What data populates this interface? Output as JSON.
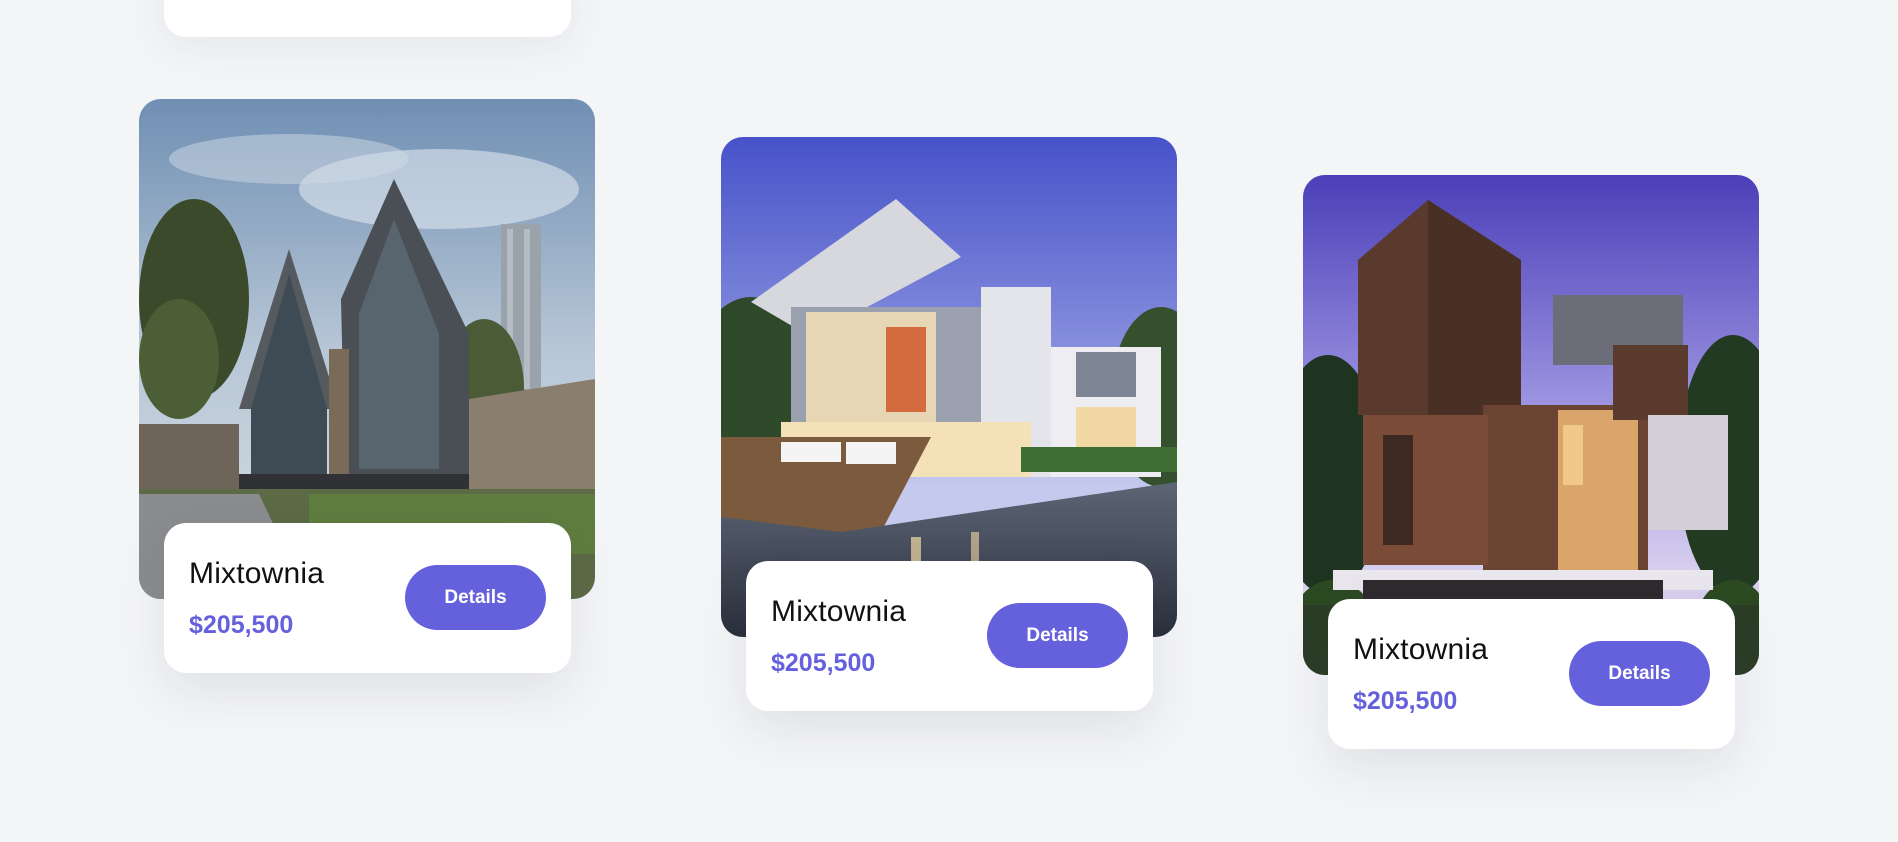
{
  "cards": [
    {
      "title": "Mixtownia",
      "price": "$205,500",
      "button": "Details"
    },
    {
      "title": "Mixtownia",
      "price": "$205,500",
      "button": "Details"
    },
    {
      "title": "Mixtownia",
      "price": "$205,500",
      "button": "Details"
    }
  ],
  "colors": {
    "accent": "#6560dc",
    "background": "#f4f5f7",
    "card": "#ffffff"
  }
}
